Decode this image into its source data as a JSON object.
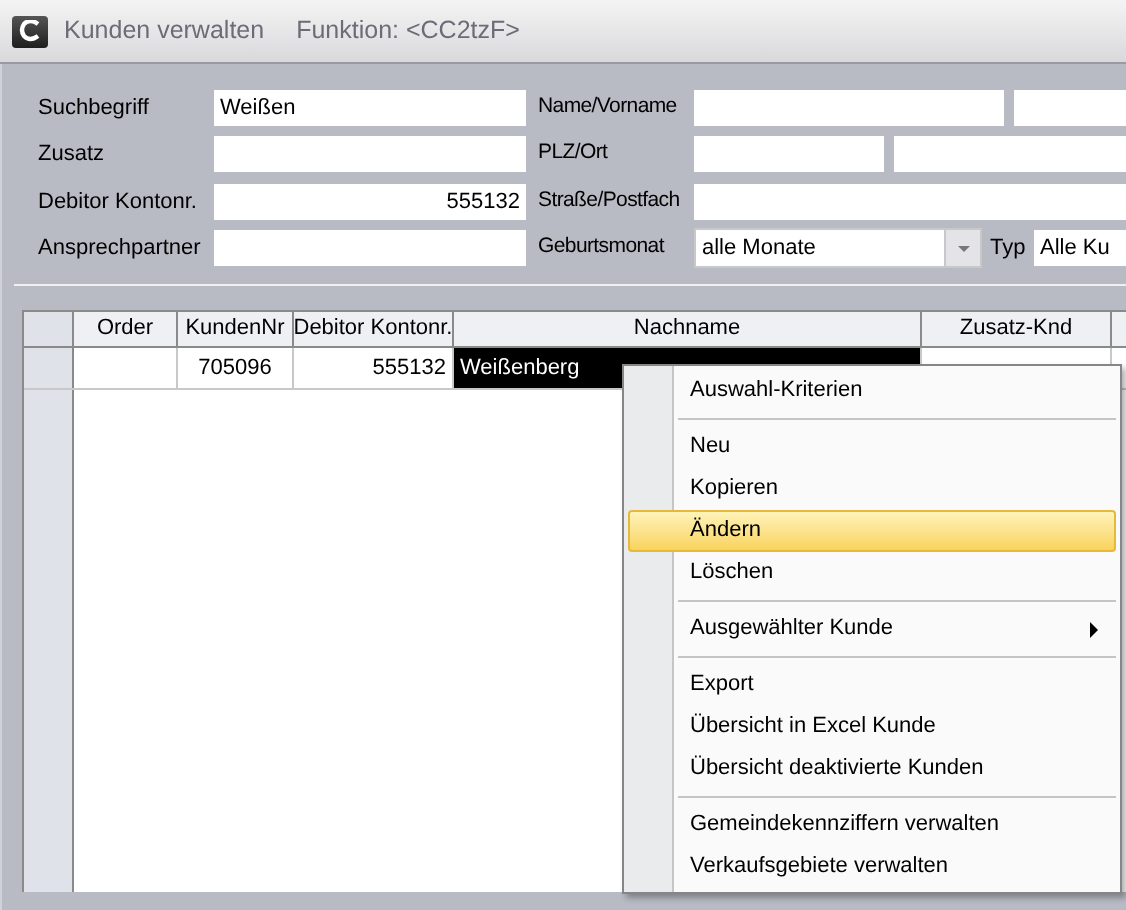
{
  "window": {
    "title": "Kunden verwalten",
    "function_label": "Funktion: <CC2tzF>"
  },
  "form": {
    "rows": [
      {
        "label": "Suchbegriff",
        "value": "Weißen",
        "label2": "Name/Vorname",
        "kind": "split"
      },
      {
        "label": "Zusatz",
        "label2": "PLZ/Ort",
        "kind": "split"
      },
      {
        "label": "Debitor Kontonr.",
        "value": "555132",
        "right_aligned": true,
        "label2": "Straße/Postfach",
        "kind": "single"
      },
      {
        "label": "Ansprechpartner",
        "label2": "Geburtsmonat",
        "kind": "combo",
        "value2": "alle Monate",
        "label3": "Typ",
        "value3": "Alle Ku"
      }
    ]
  },
  "table": {
    "columns": [
      "Order",
      "KundenNr",
      "Debitor Kontonr.",
      "Nachname",
      "Zusatz-Knd"
    ],
    "rows": [
      {
        "cells": [
          null,
          "705096",
          "555132",
          "Weißenberg",
          null
        ],
        "selected_cell": true
      }
    ]
  },
  "context_menu": {
    "groups": [
      [
        {
          "label": "Auswahl-Kriterien",
          "selected": false,
          "submenu": false
        }
      ],
      [
        {
          "label": "Neu",
          "selected": false,
          "submenu": false
        },
        {
          "label": "Kopieren",
          "selected": false,
          "submenu": false
        },
        {
          "label": "Ändern",
          "selected": true,
          "submenu": false
        },
        {
          "label": "Löschen",
          "selected": false,
          "submenu": false
        }
      ],
      [
        {
          "label": "Ausgewählter Kunde",
          "selected": false,
          "submenu": true
        }
      ],
      [
        {
          "label": "Export",
          "selected": false,
          "submenu": false
        },
        {
          "label": "Übersicht in Excel Kunde",
          "selected": false,
          "submenu": false
        },
        {
          "label": "Übersicht deaktivierte Kunden",
          "selected": false,
          "submenu": false
        }
      ],
      [
        {
          "label": "Gemeindekennziffern verwalten",
          "selected": false,
          "submenu": false
        },
        {
          "label": "Verkaufsgebiete verwalten",
          "selected": false,
          "submenu": false
        }
      ]
    ]
  }
}
